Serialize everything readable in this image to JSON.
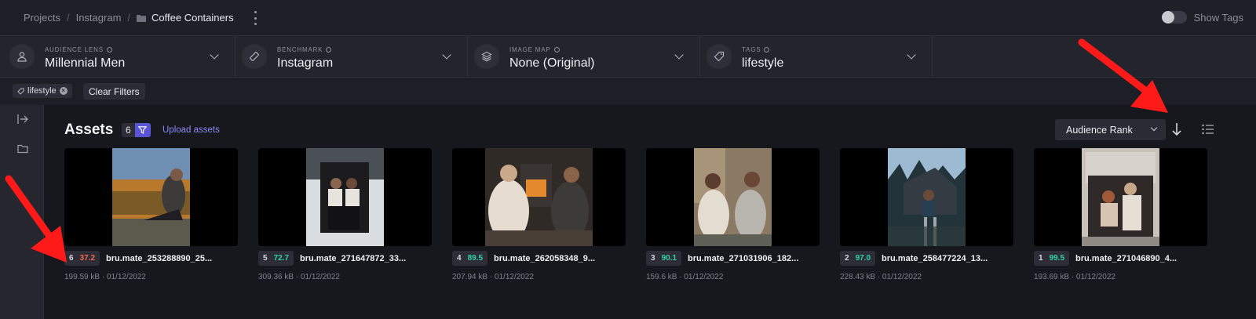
{
  "breadcrumb": {
    "projects": "Projects",
    "instagram": "Instagram",
    "current": "Coffee Containers"
  },
  "show_tags": {
    "label": "Show Tags",
    "on": false
  },
  "filters": [
    {
      "label": "AUDIENCE LENS",
      "value": "Millennial Men",
      "icon": "user-icon"
    },
    {
      "label": "BENCHMARK",
      "value": "Instagram",
      "icon": "ruler-icon"
    },
    {
      "label": "IMAGE MAP",
      "value": "None (Original)",
      "icon": "layers-icon"
    },
    {
      "label": "TAGS",
      "value": "lifestyle",
      "icon": "tag-icon"
    }
  ],
  "active_tag": "lifestyle",
  "clear_filters": "Clear Filters",
  "assets": {
    "title": "Assets",
    "count": "6",
    "upload": "Upload assets"
  },
  "sort": {
    "value": "Audience Rank"
  },
  "colors": {
    "accent": "#5a55d6",
    "score_low": "#f2664f",
    "score_high": "#2ed3a8",
    "annotation": "#ff1a1a"
  },
  "cards": [
    {
      "rank": "6",
      "score": "37.2",
      "score_color": "#f2664f",
      "name": "bru.mate_253288890_25...",
      "meta": "199.59 kB · 01/12/2022"
    },
    {
      "rank": "5",
      "score": "72.7",
      "score_color": "#2ed3a8",
      "name": "bru.mate_271647872_33...",
      "meta": "309.36 kB · 01/12/2022"
    },
    {
      "rank": "4",
      "score": "89.5",
      "score_color": "#2ed3a8",
      "name": "bru.mate_262058348_9...",
      "meta": "207.94 kB · 01/12/2022"
    },
    {
      "rank": "3",
      "score": "90.1",
      "score_color": "#2ed3a8",
      "name": "bru.mate_271031906_182...",
      "meta": "159.6 kB · 01/12/2022"
    },
    {
      "rank": "2",
      "score": "97.0",
      "score_color": "#2ed3a8",
      "name": "bru.mate_258477224_13...",
      "meta": "228.43 kB · 01/12/2022"
    },
    {
      "rank": "1",
      "score": "99.5",
      "score_color": "#2ed3a8",
      "name": "bru.mate_271046890_4...",
      "meta": "193.69 kB · 01/12/2022"
    }
  ]
}
